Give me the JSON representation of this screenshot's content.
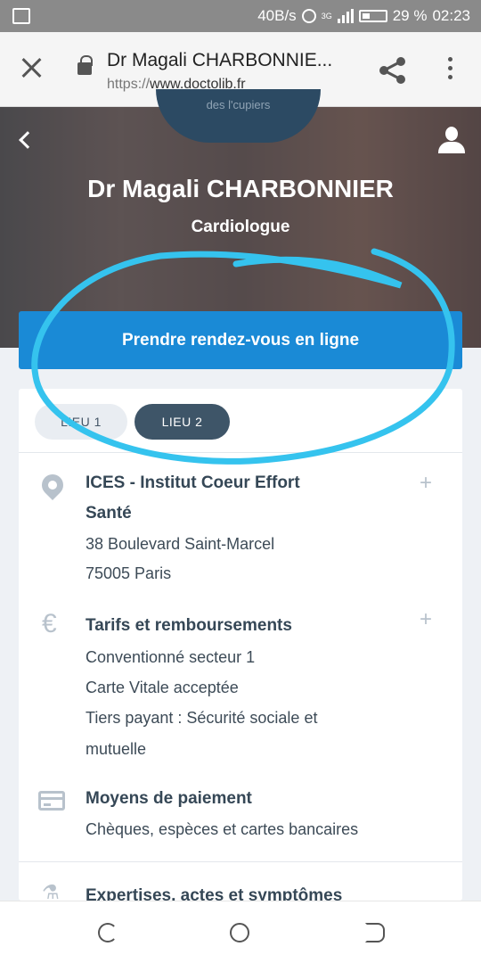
{
  "statusbar": {
    "speed": "40B/s",
    "network": "3G",
    "battery": "29 %",
    "time": "02:23"
  },
  "browser": {
    "page_title": "Dr Magali CHARBONNIE...",
    "url_scheme": "https://",
    "url_host": "www.doctolib.fr"
  },
  "hero": {
    "doctor_name": "Dr Magali CHARBONNIER",
    "specialty": "Cardiologue",
    "avatar_text": "des l'cupiers"
  },
  "cta": {
    "label": "Prendre rendez-vous en ligne"
  },
  "tabs": [
    {
      "label": "LIEU 1"
    },
    {
      "label": "LIEU 2"
    }
  ],
  "location": {
    "title_line1": "ICES - Institut Coeur Effort",
    "title_line2": "Santé",
    "address_line1": "38 Boulevard Saint-Marcel",
    "address_line2": "75005 Paris"
  },
  "tarifs": {
    "title": "Tarifs et remboursements",
    "lines": [
      "Conventionné secteur 1",
      "Carte Vitale acceptée",
      "Tiers payant : Sécurité sociale et",
      "mutuelle"
    ]
  },
  "paiement": {
    "title": "Moyens de paiement",
    "line": "Chèques, espèces et cartes bancaires"
  },
  "expertises": {
    "title": "Expertises, actes et symptômes"
  },
  "annotation_color": "#35c3ee",
  "accent": "#1a8ad6"
}
